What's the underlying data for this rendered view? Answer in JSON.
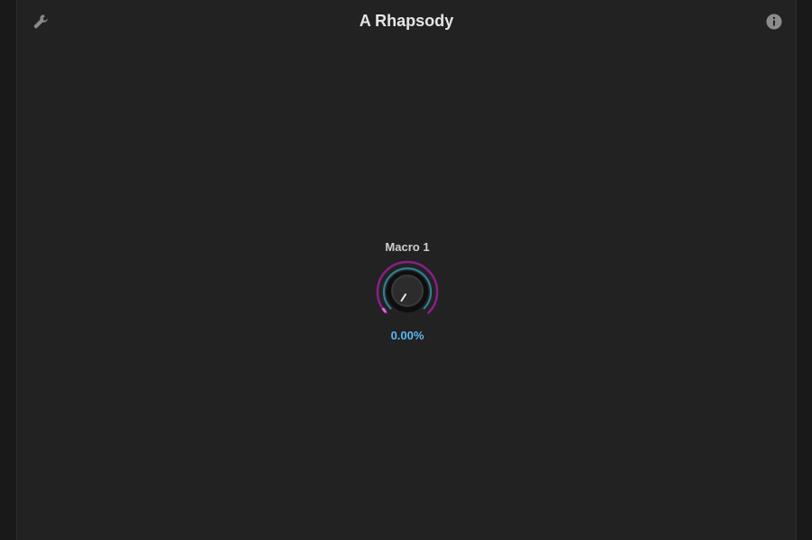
{
  "header": {
    "title": "A Rhapsody",
    "settings_icon": "wrench-icon",
    "info_icon": "info-icon"
  },
  "macro": {
    "label": "Macro 1",
    "value_text": "0.00%",
    "value": 0,
    "colors": {
      "outer_ring": "#8a1f86",
      "inner_ring": "#2f7f93",
      "value_text": "#5ab8f0",
      "indicator": "#d64fd0"
    }
  }
}
